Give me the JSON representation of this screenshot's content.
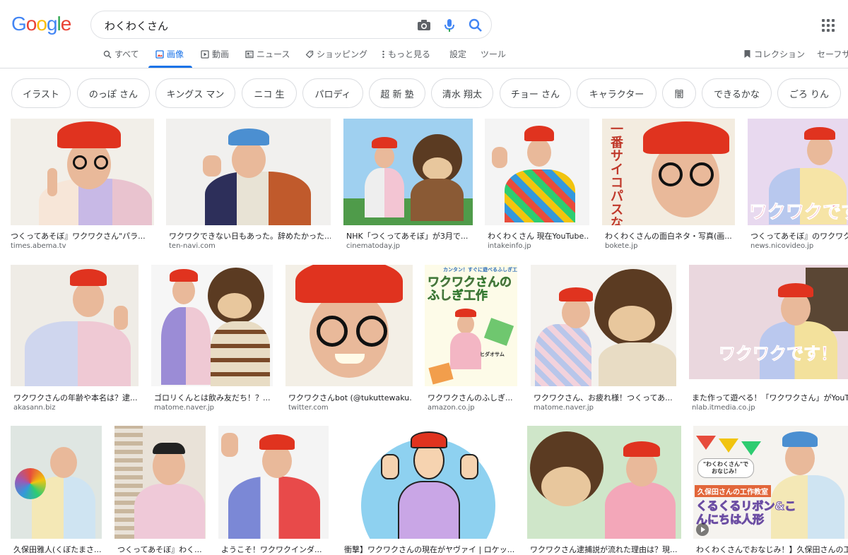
{
  "logo": "Google",
  "search": {
    "query": "わくわくさん"
  },
  "tabs": [
    {
      "label": "すべて",
      "icon": "search-icon"
    },
    {
      "label": "画像",
      "icon": "image-icon"
    },
    {
      "label": "動画",
      "icon": "play-icon"
    },
    {
      "label": "ニュース",
      "icon": "news-icon"
    },
    {
      "label": "ショッピング",
      "icon": "tag-icon"
    },
    {
      "label": "もっと見る",
      "icon": "more-vert-icon"
    },
    {
      "label": "設定"
    },
    {
      "label": "ツール"
    }
  ],
  "right_tabs": {
    "collections": "コレクション",
    "safesearch": "セーフサ"
  },
  "chips": [
    "イラスト",
    "のっぽ さん",
    "キングス マン",
    "ニコ 生",
    "パロディ",
    "超 新 塾",
    "清水 翔太",
    "チョー さん",
    "キャラクター",
    "闇",
    "できるかな",
    "ごろ りん"
  ],
  "results": [
    {
      "caption": "つくってあそぼ』ワクワクさん\"パラ...",
      "source": "times.abema.tv"
    },
    {
      "caption": "ワクワクできない日もあった。辞めたかった...",
      "source": "ten-navi.com"
    },
    {
      "caption": "NHK「つくってあそぼ」が3月で...",
      "source": "cinematoday.jp"
    },
    {
      "caption": "わくわくさん 現在YouTube...",
      "source": "intakeinfo.jp"
    },
    {
      "caption": "わくわくさんの面白ネタ・写真(画...",
      "source": "bokete.jp"
    },
    {
      "caption": "つくってあそぼ』のワクワク",
      "source": "news.nicovideo.jp"
    },
    {
      "caption": "ワクワクさんの年齢や本名は？逮...",
      "source": "akasann.biz"
    },
    {
      "caption": "ゴロリくんとは飲み友だち！？...",
      "source": "matome.naver.jp"
    },
    {
      "caption": "ワクワクさんbot (@tukuttewaku...",
      "source": "twitter.com"
    },
    {
      "caption": "ワクワクさんのふしぎ...",
      "source": "amazon.co.jp"
    },
    {
      "caption": "ワクワクさん、お疲れ様！つくってあ...",
      "source": "matome.naver.jp"
    },
    {
      "caption": "また作って遊べる！「ワクワクさん」がYouTu",
      "source": "nlab.itmedia.co.jp"
    },
    {
      "caption": "久保田雅人(くぼたまさ...",
      "source": ""
    },
    {
      "caption": "つくってあそぼ』わく...",
      "source": ""
    },
    {
      "caption": "ようこそ！ワクワクインダ...",
      "source": ""
    },
    {
      "caption": "衝撃】ワクワクさんの現在がヤヴァイ | ロケッ...",
      "source": ""
    },
    {
      "caption": "ワクワクさん逮捕説が流れた理由は？現...",
      "source": ""
    },
    {
      "caption": "わくわくさんでおなじみ！】久保田さんの工",
      "source": ""
    }
  ],
  "overlays": {
    "bokete": "一番サイコパスなこと言わせた奴が優勝",
    "nico": "ワクワクです",
    "amazon_title": "ワクワクさんのふしぎ工作",
    "amazon_top": "カンタン！すぐに遊べるふしぎ工作！",
    "amazon_author": "ヒダオサム",
    "itmedia": "ワクワクです！",
    "last_tag": "久保田さんの工作教室",
    "last_title": "くるくるリボン&こんにちは人形",
    "last_bubble": "\"わくわくさん\"でおなじみ！"
  },
  "colors": {
    "accent": "#1a73e8",
    "hat": "#e0331f"
  }
}
